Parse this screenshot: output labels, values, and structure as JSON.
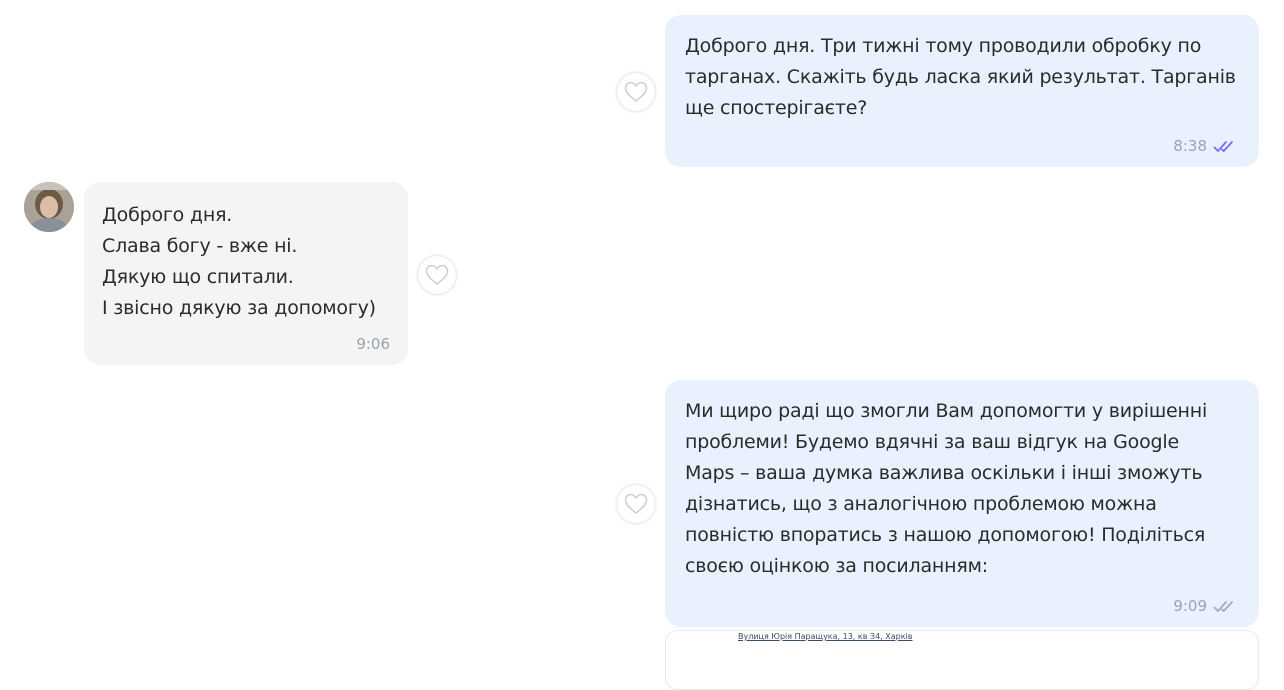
{
  "messages": [
    {
      "text": "Доброго дня. Три тижні тому проводили обробку по\nтарганах. Скажіть будь ласка який результат. Тарганів\nще спостерігаєте?",
      "time": "8:38"
    },
    {
      "text": "Доброго дня.\nСлава богу - вже ні.\nДякую що спитали.\nІ звісно дякую за допомогу)",
      "time": "9:06"
    },
    {
      "text": "Ми щиро раді що змогли Вам допомогти у вирішенні\nпроблеми! Будемо вдячні за ваш відгук на Google\nMaps – ваша думка важлива оскільки і інші зможуть\nдізнатись, що з аналогічною проблемою можна\nповністю впоратись з нашою допомогою! Поділіться\nсвоєю оцінкою за посиланням:",
      "time": "9:09"
    }
  ],
  "link_preview": {
    "address": "Вулиця Юрія Паращука, 13, кв 34, Харків"
  },
  "colors": {
    "outgoing_bubble": "#e8f1fd",
    "incoming_bubble": "#f4f4f4",
    "read_check": "#7b6cf0",
    "sent_check": "#a4acb6",
    "time_text": "#9aa3ad"
  },
  "icons": {
    "like": "heart-outline-icon",
    "read_status": "double-check-icon"
  }
}
